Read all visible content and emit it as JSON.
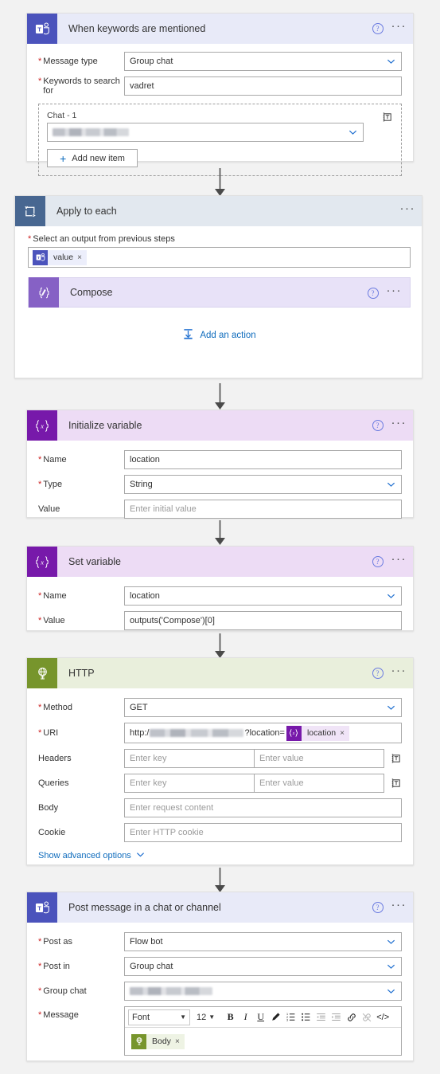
{
  "flow": {
    "cards": [
      {
        "id": "trigger-teams",
        "title": "When keywords are mentioned",
        "icon": "teams-icon",
        "help_label": "?",
        "more_label": "···",
        "fields": [
          {
            "label": "Message type",
            "required": true,
            "value": "Group chat",
            "control": "dropdown"
          },
          {
            "label": "Keywords to search for",
            "required": true,
            "value": "vadret",
            "control": "text"
          }
        ],
        "repeating_section": {
          "label": "Chat - 1",
          "value": "",
          "redacted": true,
          "add_button": "Add new item",
          "delete_icon": "trash-icon"
        }
      },
      {
        "id": "apply-to-each",
        "title": "Apply to each",
        "icon": "loop-icon",
        "more_label": "···",
        "select_output_label": "Select an output from previous steps",
        "select_output_required": true,
        "token": {
          "label": "value",
          "icon": "teams-icon",
          "remove": "×"
        },
        "nested_action": {
          "title": "Compose",
          "icon": "compose-icon",
          "help_label": "?",
          "more_label": "···"
        },
        "add_action_label": "Add an action"
      },
      {
        "id": "initialize-variable",
        "title": "Initialize variable",
        "icon": "variable-icon",
        "help_label": "?",
        "more_label": "···",
        "fields": [
          {
            "label": "Name",
            "required": true,
            "value": "location",
            "control": "text"
          },
          {
            "label": "Type",
            "required": true,
            "value": "String",
            "control": "dropdown"
          },
          {
            "label": "Value",
            "required": false,
            "value": "",
            "placeholder": "Enter initial value",
            "control": "text"
          }
        ]
      },
      {
        "id": "set-variable",
        "title": "Set variable",
        "icon": "variable-icon",
        "help_label": "?",
        "more_label": "···",
        "fields": [
          {
            "label": "Name",
            "required": true,
            "value": "location",
            "control": "dropdown"
          },
          {
            "label": "Value",
            "required": true,
            "value": "outputs('Compose')[0]",
            "control": "text"
          }
        ]
      },
      {
        "id": "http",
        "title": "HTTP",
        "icon": "globe-icon",
        "help_label": "?",
        "more_label": "···",
        "fields": [
          {
            "label": "Method",
            "required": true,
            "value": "GET",
            "control": "dropdown"
          },
          {
            "label": "URI",
            "required": true,
            "value_prefix": "http:/",
            "value_redacted": true,
            "value_suffix": "?location=",
            "token": {
              "label": "location",
              "icon": "variable-icon",
              "remove": "×"
            },
            "control": "token-text"
          },
          {
            "label": "Headers",
            "required": false,
            "key_placeholder": "Enter key",
            "value_placeholder": "Enter value",
            "control": "key-value",
            "delete_icon": "trash-icon"
          },
          {
            "label": "Queries",
            "required": false,
            "key_placeholder": "Enter key",
            "value_placeholder": "Enter value",
            "control": "key-value",
            "delete_icon": "trash-icon"
          },
          {
            "label": "Body",
            "required": false,
            "value": "",
            "placeholder": "Enter request content",
            "control": "text"
          },
          {
            "label": "Cookie",
            "required": false,
            "value": "",
            "placeholder": "Enter HTTP cookie",
            "control": "text"
          }
        ],
        "advanced_label": "Show advanced options"
      },
      {
        "id": "post-message",
        "title": "Post message in a chat or channel",
        "icon": "teams-icon",
        "help_label": "?",
        "more_label": "···",
        "fields": [
          {
            "label": "Post as",
            "required": true,
            "value": "Flow bot",
            "control": "dropdown"
          },
          {
            "label": "Post in",
            "required": true,
            "value": "Group chat",
            "control": "dropdown"
          },
          {
            "label": "Group chat",
            "required": true,
            "value": "",
            "redacted": true,
            "control": "dropdown"
          },
          {
            "label": "Message",
            "required": true,
            "control": "rich-text"
          }
        ],
        "rich_text": {
          "font_label": "Font",
          "size_label": "12",
          "buttons": [
            {
              "name": "bold-icon",
              "glyph": "B"
            },
            {
              "name": "italic-icon",
              "glyph": "I"
            },
            {
              "name": "underline-icon",
              "glyph": "U"
            },
            {
              "name": "highlighter-icon",
              "glyph": "✐"
            },
            {
              "name": "numbered-list-icon",
              "glyph": ""
            },
            {
              "name": "bulleted-list-icon",
              "glyph": ""
            },
            {
              "name": "decrease-indent-icon",
              "glyph": ""
            },
            {
              "name": "increase-indent-icon",
              "glyph": ""
            },
            {
              "name": "link-icon",
              "glyph": ""
            },
            {
              "name": "unlink-icon",
              "glyph": ""
            },
            {
              "name": "code-view-icon",
              "glyph": "</>"
            }
          ],
          "token": {
            "label": "Body",
            "icon": "globe-icon",
            "remove": "×"
          }
        }
      }
    ]
  },
  "colors": {
    "teams_icon_bg": "#4b53bc",
    "loop_icon_bg": "#486791",
    "variable_icon_bg": "#7719aa",
    "compose_icon_bg": "#8661c5",
    "http_icon_bg": "#77952c",
    "link_blue": "#0f6cbd",
    "required_red": "#cc2222",
    "page_bg": "#f2f2f2"
  }
}
